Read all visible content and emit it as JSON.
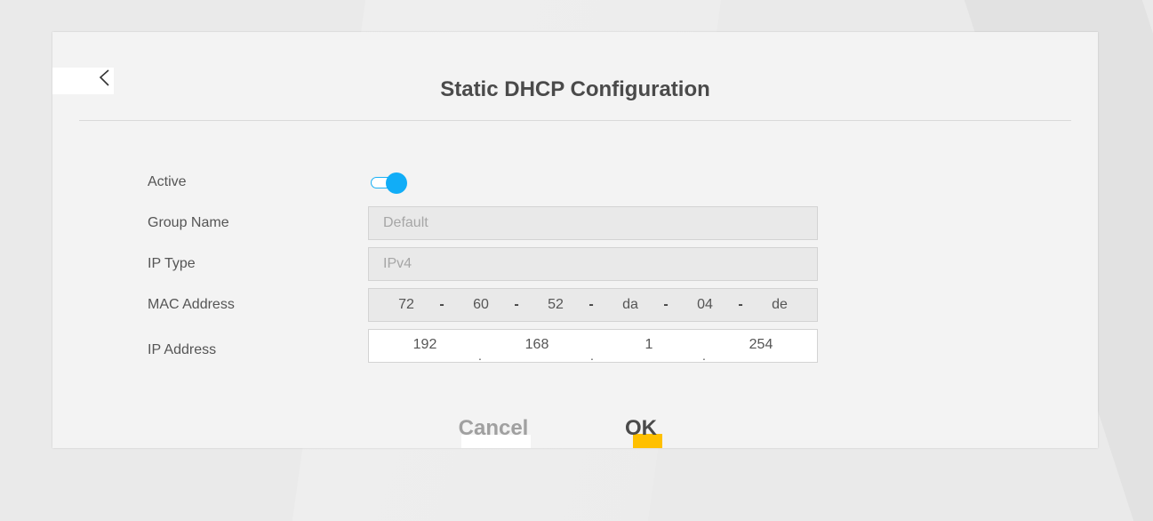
{
  "dialog": {
    "title": "Static DHCP Configuration"
  },
  "form": {
    "active_label": "Active",
    "active_value": true,
    "group_name_label": "Group Name",
    "group_name_value": "Default",
    "ip_type_label": "IP Type",
    "ip_type_value": "IPv4",
    "mac_label": "MAC Address",
    "mac": [
      "72",
      "60",
      "52",
      "da",
      "04",
      "de"
    ],
    "mac_separator": "-",
    "ip_label": "IP Address",
    "ip": [
      "192",
      "168",
      "1",
      "254"
    ],
    "ip_separator": "."
  },
  "actions": {
    "cancel_label": "Cancel",
    "ok_label": "OK"
  },
  "colors": {
    "toggle_accent": "#11adf7",
    "ok_accent": "#ffc000"
  }
}
